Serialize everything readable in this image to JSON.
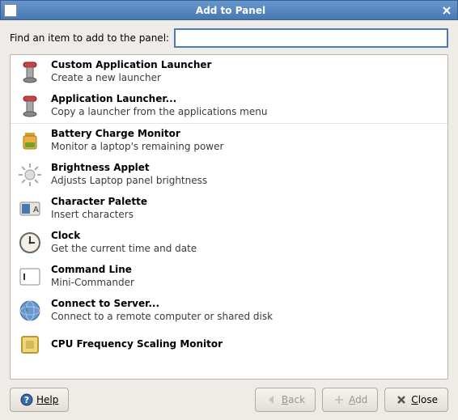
{
  "titlebar": {
    "title": "Add to Panel"
  },
  "search": {
    "label": "Find an item to add to the panel:",
    "value": "",
    "placeholder": ""
  },
  "items": [
    {
      "icon": "launcher",
      "name": "Custom Application Launcher",
      "desc": "Create a new launcher",
      "sep": false
    },
    {
      "icon": "launcher",
      "name": "Application Launcher...",
      "desc": "Copy a launcher from the applications menu",
      "sep": true
    },
    {
      "icon": "battery",
      "name": "Battery Charge Monitor",
      "desc": "Monitor a laptop's remaining power",
      "sep": false
    },
    {
      "icon": "brightness",
      "name": "Brightness Applet",
      "desc": "Adjusts Laptop panel brightness",
      "sep": false
    },
    {
      "icon": "palette",
      "name": "Character Palette",
      "desc": "Insert characters",
      "sep": false
    },
    {
      "icon": "clock",
      "name": "Clock",
      "desc": "Get the current time and date",
      "sep": false
    },
    {
      "icon": "terminal",
      "name": "Command Line",
      "desc": "Mini-Commander",
      "sep": false
    },
    {
      "icon": "globe",
      "name": "Connect to Server...",
      "desc": "Connect to a remote computer or shared disk",
      "sep": false
    },
    {
      "icon": "cpu",
      "name": "CPU Frequency Scaling Monitor",
      "desc": "",
      "sep": false
    }
  ],
  "buttons": {
    "help": "Help",
    "back": "Back",
    "add": "Add",
    "close": "Close"
  }
}
